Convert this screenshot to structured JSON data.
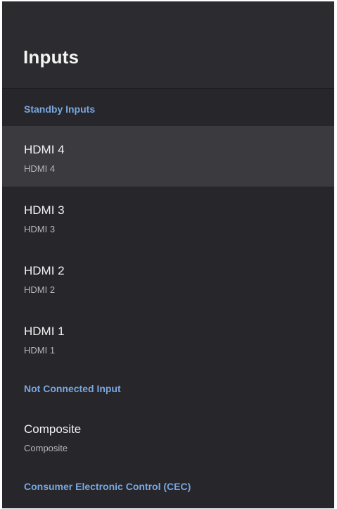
{
  "page": {
    "title": "Inputs"
  },
  "sections": {
    "standby": {
      "label": "Standby Inputs",
      "items": [
        {
          "title": "HDMI 4",
          "subtitle": "HDMI 4"
        },
        {
          "title": "HDMI 3",
          "subtitle": "HDMI 3"
        },
        {
          "title": "HDMI 2",
          "subtitle": "HDMI 2"
        },
        {
          "title": "HDMI 1",
          "subtitle": "HDMI 1"
        }
      ]
    },
    "not_connected": {
      "label": "Not Connected Input",
      "items": [
        {
          "title": "Composite",
          "subtitle": "Composite"
        }
      ]
    },
    "cec": {
      "label": "Consumer Electronic Control (CEC)"
    }
  },
  "colors": {
    "background": "#26262b",
    "header_background": "#2c2c30",
    "focused_row": "#3a3a3f",
    "section_accent": "#7aa7e0"
  }
}
